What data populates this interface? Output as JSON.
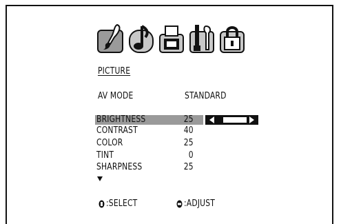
{
  "menu": {
    "title": "PICTURE",
    "icons": [
      "picture-icon",
      "audio-icon",
      "timer-icon",
      "setup-icon",
      "lock-icon"
    ],
    "selected_icon": "picture-icon"
  },
  "av_mode": {
    "label": "AV MODE",
    "value": "STANDARD"
  },
  "settings": [
    {
      "label": "BRIGHTNESS",
      "value": "25",
      "level": 0.5,
      "selected": true
    },
    {
      "label": "CONTRAST",
      "value": "40"
    },
    {
      "label": "COLOR",
      "value": "25"
    },
    {
      "label": "TINT",
      "value": "0"
    },
    {
      "label": "SHARPNESS",
      "value": "25"
    }
  ],
  "more_indicator": "down-arrow-icon",
  "footer": {
    "select_label": ":SELECT",
    "adjust_label": ":ADJUST",
    "select_icon": "up-down-control-icon",
    "adjust_icon": "left-right-control-icon"
  },
  "colors": {
    "highlight": "#9a9a9a",
    "slider": "#111111",
    "background": "#ffffff"
  }
}
